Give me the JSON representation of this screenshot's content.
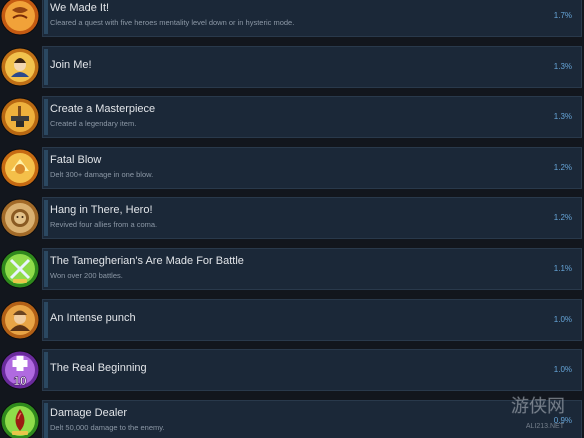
{
  "achievements": [
    {
      "title": "We Made It!",
      "description": "Cleared a quest with five heroes mentality level down or in hysteric mode.",
      "percent": "1.7%",
      "icon": "achievement-quest-icon",
      "colors": {
        "outer": "#c45a12",
        "inner": "#f1a239"
      }
    },
    {
      "title": "Join Me!",
      "description": "",
      "percent": "1.3%",
      "icon": "achievement-hero-portrait-icon",
      "colors": {
        "outer": "#c07016",
        "inner": "#f2c24d"
      }
    },
    {
      "title": "Create a Masterpiece",
      "description": "Created a legendary item.",
      "percent": "1.3%",
      "icon": "achievement-anvil-icon",
      "colors": {
        "outer": "#b86812",
        "inner": "#eeb03c"
      }
    },
    {
      "title": "Fatal Blow",
      "description": "Delt 300+ damage in one blow.",
      "percent": "1.2%",
      "icon": "achievement-fist-icon",
      "colors": {
        "outer": "#c66a12",
        "inner": "#f4c04a"
      }
    },
    {
      "title": "Hang in There, Hero!",
      "description": "Revived four allies from a coma.",
      "percent": "1.2%",
      "icon": "achievement-lion-icon",
      "colors": {
        "outer": "#a26a28",
        "inner": "#d9b070"
      }
    },
    {
      "title": "The Tamegherian's Are Made For Battle",
      "description": "Won over 200 battles.",
      "percent": "1.1%",
      "icon": "achievement-crossed-swords-icon",
      "colors": {
        "outer": "#2f8a1c",
        "inner": "#8fdc4a"
      }
    },
    {
      "title": "An Intense punch",
      "description": "",
      "percent": "1.0%",
      "icon": "achievement-warrior-portrait-icon",
      "colors": {
        "outer": "#b26016",
        "inner": "#e8a546"
      }
    },
    {
      "title": "The Real Beginning",
      "description": "",
      "percent": "1.0%",
      "icon": "achievement-level-up-icon",
      "level_badge": "10",
      "colors": {
        "outer": "#6a2b9c",
        "inner": "#b06ae0"
      }
    },
    {
      "title": "Damage Dealer",
      "description": "Delt 50,000 damage to the enemy.",
      "percent": "0.9%",
      "icon": "achievement-blood-drop-icon",
      "colors": {
        "outer": "#2f8a1c",
        "inner": "#8fdc4a"
      }
    }
  ],
  "watermark": {
    "logo_text": "游侠网",
    "url": "ALI213.NET"
  }
}
